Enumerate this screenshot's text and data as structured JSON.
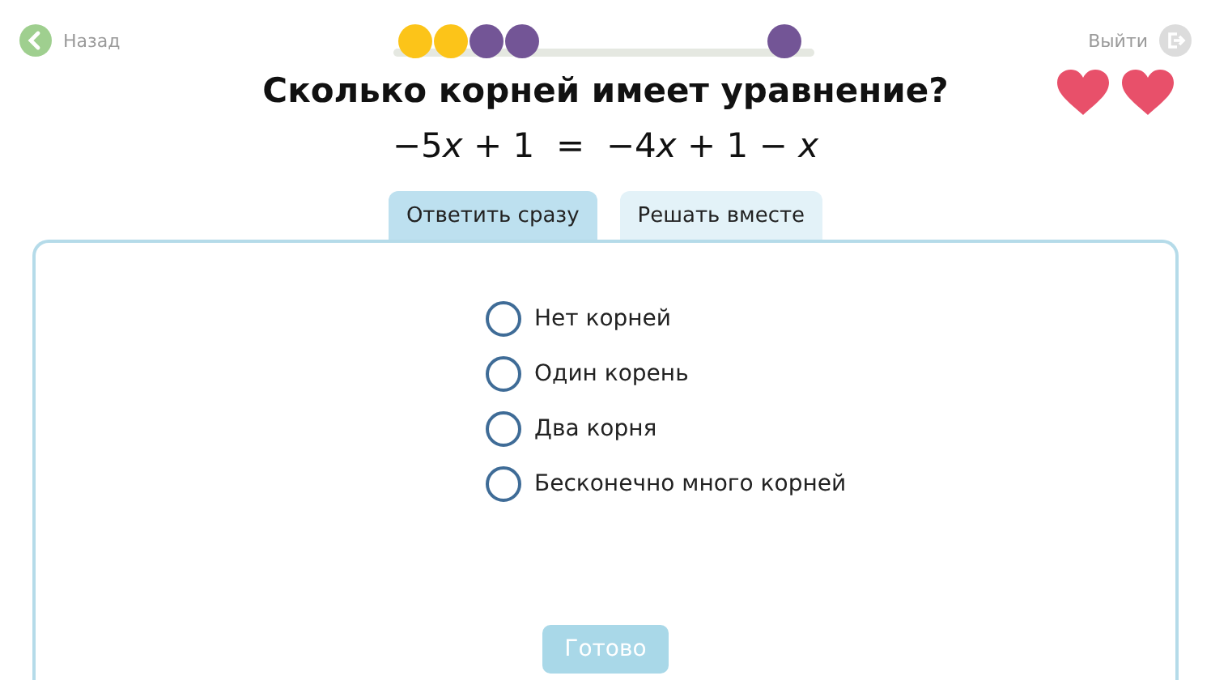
{
  "header": {
    "back": "Назад",
    "exit": "Выйти"
  },
  "progress": [
    {
      "color": "#fcc419"
    },
    {
      "color": "#fcc419"
    },
    {
      "color": "#735596"
    },
    {
      "color": "#735596"
    },
    {
      "color": "#735596"
    }
  ],
  "hearts": [
    {
      "filled": true
    },
    {
      "filled": true
    }
  ],
  "question": "Сколько корней имеет уравнение?",
  "equation": [
    {
      "text": "−5",
      "italic": false
    },
    {
      "text": "x",
      "italic": true
    },
    {
      "text": " + 1  =  −4",
      "italic": false
    },
    {
      "text": "x",
      "italic": true
    },
    {
      "text": " + 1 − ",
      "italic": false
    },
    {
      "text": "x",
      "italic": true
    }
  ],
  "tabs": [
    {
      "label": "Ответить сразу",
      "selected": true
    },
    {
      "label": "Решать вместе",
      "selected": false
    }
  ],
  "options": [
    {
      "label": "Нет корней",
      "selected": false
    },
    {
      "label": "Один корень",
      "selected": false
    },
    {
      "label": "Два корня",
      "selected": false
    },
    {
      "label": "Бесконечно много корней",
      "selected": false
    }
  ],
  "submit": {
    "label": "Готово",
    "disabled": true
  }
}
